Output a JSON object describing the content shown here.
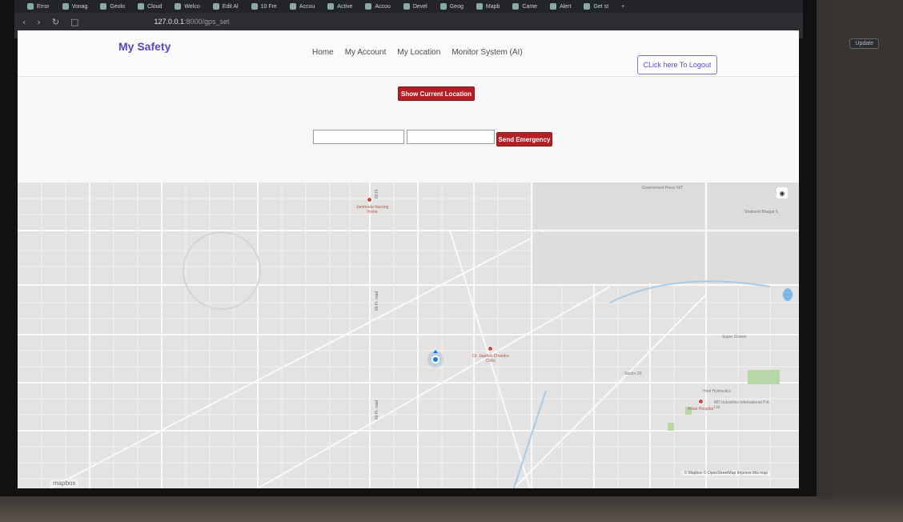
{
  "browser": {
    "tabs": [
      {
        "label": "Error"
      },
      {
        "label": "Vonag"
      },
      {
        "label": "Geolo"
      },
      {
        "label": "Cloud"
      },
      {
        "label": "Welco"
      },
      {
        "label": "Edit Al"
      },
      {
        "label": "10 Fre"
      },
      {
        "label": "Accou"
      },
      {
        "label": "Active"
      },
      {
        "label": "Accou"
      },
      {
        "label": "Devel"
      },
      {
        "label": "Geog"
      },
      {
        "label": "Mapb"
      },
      {
        "label": "Came"
      },
      {
        "label": "Alert"
      },
      {
        "label": "Get st"
      }
    ],
    "url_host": "127.0.0.1",
    "url_rest": ":8000/gps_set",
    "update_label": "Update"
  },
  "navbar": {
    "brand": "My Safety",
    "links": [
      "Home",
      "My Account",
      "My Location",
      "Monitor System (AI)"
    ],
    "logout_label": "CLick here To Logout"
  },
  "controls": {
    "show_location_label": "Show Current Location",
    "send_emergency_label": "Send Emergency"
  },
  "map": {
    "labels": {
      "top_right": "Government Press NIT",
      "shaheed": "Shaheed Bhagat S",
      "super_screen": "Super Screen",
      "sector": "Sector 20",
      "hind": "Hind Hydraulics",
      "md": "MD Industries International Pvt. Ltd."
    },
    "pois": {
      "poi1": "Jammoda Nursing Home",
      "poi2": "Dr. Jagdish Chandra Clinic",
      "poi3": "Asian Hospital"
    },
    "roads": {
      "r1": "60 Ft",
      "r2": "60 Ft. road",
      "r3": "60 Ft. road"
    },
    "attribution": "© Mapbox © OpenStreetMap Improve this map",
    "logo": "mapbox"
  }
}
